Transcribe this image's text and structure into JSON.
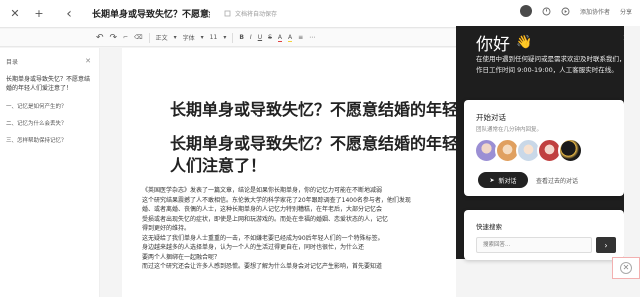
{
  "topbar": {
    "close": "✕",
    "add": "+",
    "back": "‹",
    "title": "长期单身或导致失忆？不愿意结婚的",
    "autosave": "文档将自动保存",
    "right_links": [
      "添加协作者",
      "分享"
    ]
  },
  "toolbar": {
    "undo": "↶",
    "redo": "↷",
    "format_brush": "⌐",
    "clear": "⌫",
    "paragraph": "正文",
    "font": "字体",
    "size": "11",
    "bold": "B",
    "italic": "I",
    "underline": "U",
    "strike": "S",
    "color": "A",
    "highlight": "A",
    "lists": "≡",
    "extras": "⋯"
  },
  "toc": {
    "header": "目录",
    "close": "✕",
    "main": "长期单身或导致失忆？不愿意结婚的年轻人们爱注意了！",
    "items": [
      "一、记忆是如何产生的？",
      "二、记忆为什么会丢失？",
      "三、怎样帮助保持记忆？"
    ]
  },
  "doc": {
    "h1": "长期单身或导致失忆？不愿意结婚的年轻人们",
    "h2": "长期单身或导致失忆？不愿意结婚的年轻人们注意了！",
    "body_lines": [
      "《英国医学杂志》发表了一篇文章，结论是如果你长期单身，你的记忆力可能在不断地减弱",
      "这个研究结果震撼了人不敢相信。东伦敦大学的科学家花了20年跟踪调查了1400名参与者，他们发现",
      "婚、或者离婚、丧偶的人士，这种长期单身的人记忆力特别糟糕，在年老后，大部分记忆会",
      "受损或者出现失忆的症状，即使是上网和玩游戏的。而处在幸福的婚姻、恋爱状态的人，记忆",
      "得到更好的维持。",
      "这无疑给了我们单身人士重重的一击，不如嫌老要已经成为90后年轻人们的一个特殊标签。",
      "身边越来越多的人选择单身，认为一个人的生活过得更自在，同时也很忙，为什么还",
      "要两个人捆绑在一起融合呢？",
      "而过这个研究还会让许多人感到恐慌。要想了解为什么单身会对记忆产生影响，首先要知道"
    ]
  },
  "chat_panel": {
    "greeting": "你好",
    "wave_icon": "👋",
    "close": "✕",
    "intro": "在使用中遇到任何疑问或是需求欢迎及时联系我们，工作日工作时间 9:00-19:00，人工客服实时在线。",
    "card_title": "开始对话",
    "card_subtitle": "团队通常在几分钟内回复。",
    "new_chat": "新对话",
    "past_chats": "查看过去的对话",
    "search_title": "快速搜索",
    "search_placeholder": "搜索回答...",
    "search_btn": "›"
  },
  "colors": {
    "panel_bg": "#1e1e1e",
    "accent_dark": "#222222",
    "avatar_1": "#9b8fd4",
    "avatar_2": "#e8c4a0",
    "avatar_3": "#c9d8e8",
    "avatar_4": "#1a1a1a"
  }
}
